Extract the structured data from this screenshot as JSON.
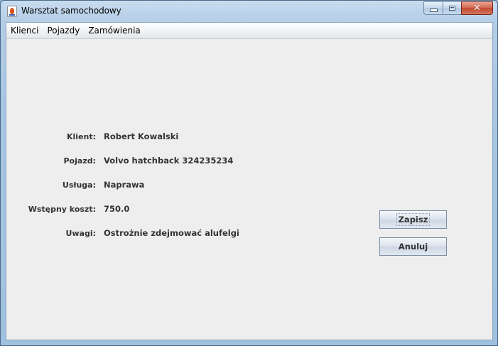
{
  "window": {
    "title": "Warsztat samochodowy"
  },
  "menu": {
    "items": [
      "Klienci",
      "Pojazdy",
      "Zamówienia"
    ]
  },
  "form": {
    "client_label": "Klient:",
    "client_value": "Robert Kowalski",
    "vehicle_label": "Pojazd:",
    "vehicle_value": "Volvo hatchback 324235234",
    "service_label": "Usługa:",
    "service_value": "Naprawa",
    "cost_label": "Wstępny koszt:",
    "cost_value": "750.0",
    "notes_label": "Uwagi:",
    "notes_value": "Ostrożnie zdejmować alufelgi"
  },
  "buttons": {
    "save_label": "Zapisz",
    "cancel_label": "Anuluj"
  },
  "colors": {
    "accent": "#a8c6e3",
    "panel": "#eeeeee",
    "text": "#333333",
    "close_button": "#c24a30"
  },
  "icons": {
    "app": "java-icon",
    "minimize": "minimize-icon",
    "maximize": "maximize-icon",
    "close": "close-icon"
  }
}
